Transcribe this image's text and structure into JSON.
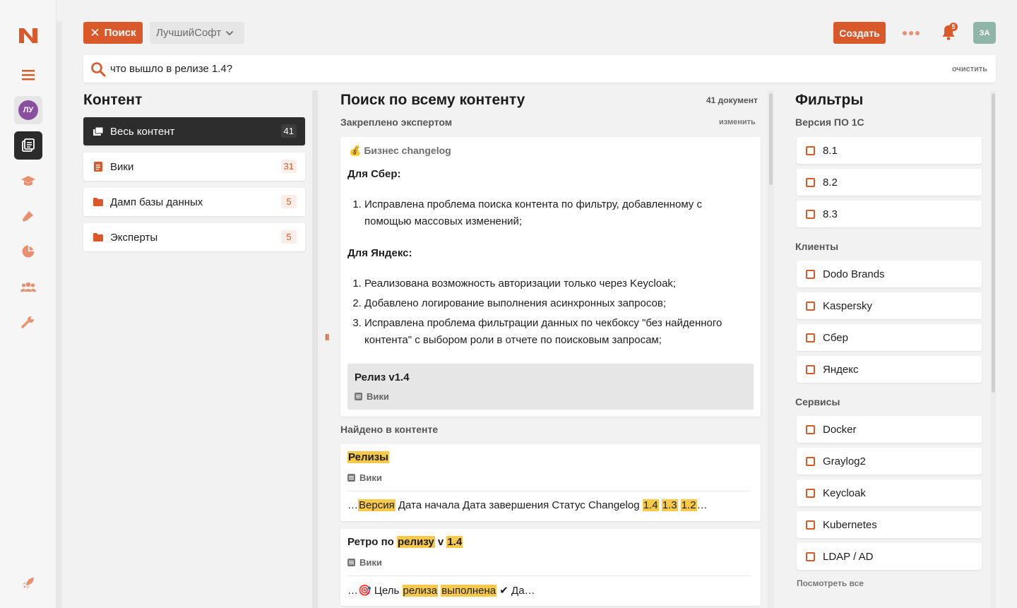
{
  "app": {
    "logo": "N"
  },
  "rail": {
    "avatar_initials": "ЛУ"
  },
  "header": {
    "search_button": "Поиск",
    "workspace": "ЛучшийСофт",
    "create_button": "Создать",
    "notifications_count": "5",
    "user_initials": "ЗА"
  },
  "search": {
    "query": "что вышло в релизе 1.4?",
    "clear_label": "очистить"
  },
  "content": {
    "title": "Контент",
    "items": [
      {
        "label": "Весь контент",
        "count": "41"
      },
      {
        "label": "Вики",
        "count": "31"
      },
      {
        "label": "Дамп базы данных",
        "count": "5"
      },
      {
        "label": "Эксперты",
        "count": "5"
      }
    ]
  },
  "results": {
    "title": "Поиск по всему контенту",
    "doc_count": "41 документ",
    "pinned_label": "Закреплено экспертом",
    "edit_label": "изменить",
    "pinned": {
      "title": "💰 Бизнес changelog",
      "sber_heading": "Для Сбер:",
      "sber_items": [
        "Исправлена проблема поиска контента по фильтру, добавленному с помощью массовых изменений;"
      ],
      "yandex_heading": "Для Яндекс:",
      "yandex_items": [
        "Реализована возможность авторизации только через Keycloak;",
        "Добавлено логирование выполнения асинхронных запросов;",
        "Исправлена проблема фильтрации данных по чекбоксу \"без найденного контента\" с выбором роли в отчете по поисковым запросам;"
      ],
      "release_title": "Релиз v1.4",
      "release_source": "Вики"
    },
    "found_label": "Найдено в контенте",
    "items": [
      {
        "title_hl": "Релизы",
        "source": "Вики",
        "snip_pre": "…",
        "snip_hl1": "Версия",
        "snip_mid": " Дата начала Дата завершения Статус Changelog ",
        "snip_hl2": "1.4",
        "snip_hl3": "1.3",
        "snip_hl4": "1.2",
        "snip_end": "…"
      },
      {
        "title_pre": "Ретро по ",
        "title_hl1": "релизу",
        "title_mid": " v ",
        "title_hl2": "1.4",
        "source": "Вики",
        "snip_pre": "…🎯 Цель ",
        "snip_hl1": "релиза",
        "snip_hl2": "выполнена",
        "snip_end": " ✔ Да…"
      }
    ]
  },
  "filters": {
    "title": "Фильтры",
    "groups": [
      {
        "label": "Версия ПО 1С",
        "options": [
          "8.1",
          "8.2",
          "8.3"
        ]
      },
      {
        "label": "Клиенты",
        "options": [
          "Dodo Brands",
          "Kaspersky",
          "Сбер",
          "Яндекс"
        ]
      },
      {
        "label": "Сервисы",
        "options": [
          "Docker",
          "Graylog2",
          "Keycloak",
          "Kubernetes",
          "LDAP / AD"
        ]
      }
    ],
    "see_all": "Посмотреть все"
  },
  "colors": {
    "accent": "#d9592b",
    "highlight": "#f6c94a",
    "active_nav": "#2d2d2d"
  }
}
